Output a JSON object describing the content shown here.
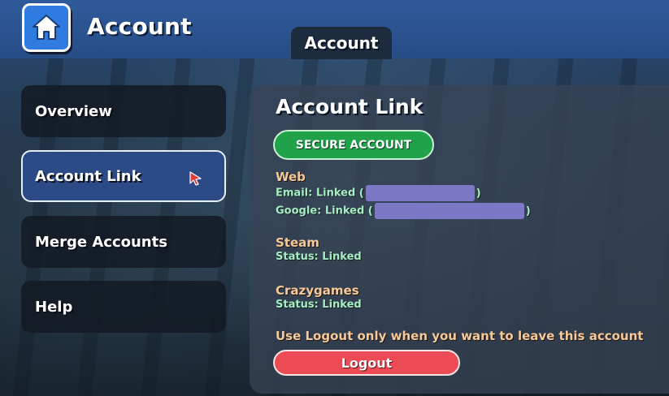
{
  "header": {
    "title": "Account",
    "home_icon": "home-icon"
  },
  "tab": {
    "label": "Account"
  },
  "sidebar": {
    "items": [
      {
        "label": "Overview",
        "active": false
      },
      {
        "label": "Account Link",
        "active": true
      },
      {
        "label": "Merge Accounts",
        "active": false
      },
      {
        "label": "Help",
        "active": false
      }
    ]
  },
  "panel": {
    "heading": "Account Link",
    "secure_button_label": "SECURE ACCOUNT",
    "web": {
      "title": "Web",
      "email": "Email: Linked",
      "google": "Google: Linked"
    },
    "steam": {
      "title": "Steam",
      "status": "Status: Linked"
    },
    "crazygames": {
      "title": "Crazygames",
      "status": "Status: Linked"
    },
    "warning": "Use Logout only when you want to leave this account",
    "logout_label": "Logout"
  },
  "colors": {
    "topbar": "#274d86",
    "home_button": "#2f7be0",
    "active_item": "#2c4a86",
    "secure_button": "#1fa24a",
    "logout_button": "#ec4a55",
    "section_title": "#f6c99a",
    "status_text": "#a7ecc4",
    "redaction": "#7d78c6"
  }
}
